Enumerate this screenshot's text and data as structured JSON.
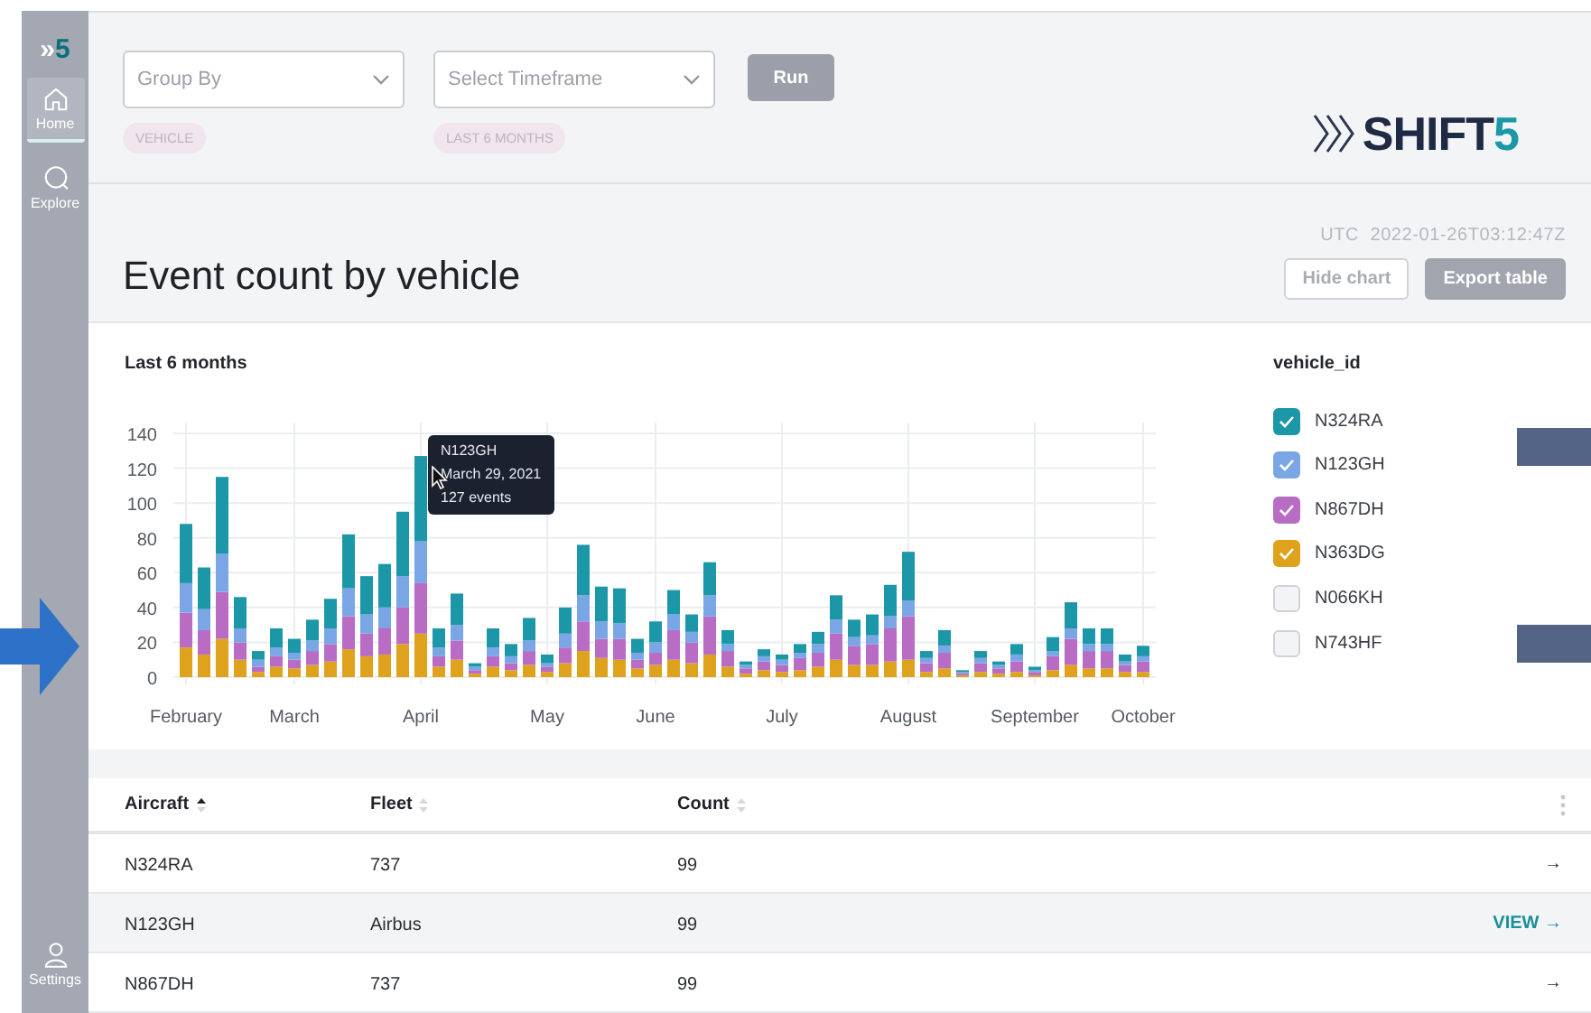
{
  "sidebar": {
    "logo": {
      "mark": "»",
      "accent": "5"
    },
    "items": [
      {
        "label": "Home",
        "selected": true
      },
      {
        "label": "Explore",
        "selected": false
      }
    ],
    "footer": {
      "label": "Settings"
    }
  },
  "toolbar": {
    "selects": [
      {
        "placeholder": "Group By",
        "chip": "VEHICLE"
      },
      {
        "placeholder": "Select Timeframe",
        "chip": "LAST 6 MONTHS"
      }
    ],
    "run_button": "Run",
    "logo": {
      "text": "SHIFT",
      "accent": "5"
    }
  },
  "report": {
    "timestamp": "UTC  2022-01-26T03:12:47Z",
    "title": "Event count by vehicle",
    "buttons": [
      {
        "label": "Hide chart",
        "kind": "outline"
      },
      {
        "label": "Export table",
        "kind": "filled"
      }
    ]
  },
  "chart": {
    "subtitle": "Last 6 months",
    "tooltip": [
      "N123GH",
      "March 29, 2021",
      "127 events"
    ],
    "chart_data": {
      "type": "bar",
      "stacked": true,
      "grid": true,
      "categories": [
        "February",
        null,
        null,
        null,
        null,
        null,
        "March",
        null,
        null,
        null,
        null,
        null,
        null,
        "April",
        null,
        null,
        null,
        null,
        null,
        null,
        "May",
        null,
        null,
        null,
        null,
        null,
        "June",
        null,
        null,
        null,
        null,
        null,
        null,
        "July",
        null,
        null,
        null,
        null,
        null,
        null,
        "August",
        null,
        null,
        null,
        null,
        null,
        null,
        "September",
        null,
        null,
        null,
        null,
        null,
        "October"
      ],
      "ylim": [
        0,
        140
      ],
      "yticks": [
        0,
        20,
        40,
        60,
        80,
        100,
        120,
        140
      ],
      "series": [
        {
          "color": "#dea21c",
          "values": [
            17,
            13,
            22,
            10,
            3,
            6,
            5,
            7,
            9,
            16,
            12,
            13,
            19,
            25,
            6,
            10,
            2,
            6,
            4,
            7,
            3,
            8,
            15,
            11,
            10,
            5,
            7,
            10,
            8,
            13,
            6,
            2,
            4,
            3,
            4,
            6,
            10,
            7,
            7,
            9,
            10,
            3,
            5,
            1,
            3,
            2,
            3,
            1,
            4,
            7,
            5,
            5,
            3,
            3
          ]
        },
        {
          "color": "#b86cc4",
          "values": [
            20,
            14,
            27,
            10,
            3,
            6,
            5,
            8,
            10,
            19,
            13,
            15,
            21,
            29,
            6,
            11,
            2,
            6,
            4,
            8,
            3,
            9,
            17,
            11,
            12,
            5,
            7,
            17,
            12,
            22,
            9,
            3,
            5,
            4,
            7,
            8,
            15,
            11,
            12,
            19,
            25,
            5,
            9,
            1,
            5,
            3,
            6,
            2,
            8,
            15,
            10,
            10,
            4,
            6
          ]
        },
        {
          "color": "#7aa6e6",
          "values": [
            17,
            12,
            22,
            8,
            4,
            5,
            4,
            6,
            9,
            16,
            11,
            12,
            18,
            24,
            5,
            9,
            2,
            5,
            4,
            6,
            2,
            8,
            15,
            10,
            9,
            4,
            6,
            9,
            6,
            12,
            4,
            2,
            3,
            3,
            3,
            5,
            8,
            5,
            5,
            7,
            9,
            3,
            4,
            1,
            3,
            2,
            4,
            1,
            3,
            6,
            4,
            4,
            2,
            3
          ]
        },
        {
          "color": "#1b97a8",
          "values": [
            34,
            24,
            44,
            18,
            5,
            11,
            8,
            12,
            17,
            31,
            22,
            25,
            37,
            49,
            11,
            18,
            2,
            11,
            7,
            13,
            5,
            15,
            29,
            20,
            20,
            8,
            12,
            14,
            10,
            19,
            8,
            2,
            4,
            3,
            5,
            7,
            14,
            10,
            12,
            18,
            28,
            4,
            9,
            1,
            4,
            2,
            6,
            2,
            8,
            15,
            9,
            9,
            4,
            6
          ]
        }
      ]
    },
    "legend": {
      "title": "vehicle_id",
      "items": [
        {
          "label": "N324RA",
          "checked": true,
          "color": "#1b97a8"
        },
        {
          "label": "N123GH",
          "checked": true,
          "color": "#7aa6e6"
        },
        {
          "label": "N867DH",
          "checked": true,
          "color": "#b86cc4"
        },
        {
          "label": "N363DG",
          "checked": true,
          "color": "#dea21c"
        },
        {
          "label": "N066KH",
          "checked": false,
          "color": "#f3f4f5"
        },
        {
          "label": "N743HF",
          "checked": false,
          "color": "#f3f4f5"
        }
      ]
    }
  },
  "table": {
    "columns": [
      {
        "label": "Aircraft",
        "sorted": true
      },
      {
        "label": "Fleet",
        "sorted": false
      },
      {
        "label": "Count",
        "sorted": false
      }
    ],
    "rows": [
      {
        "cells": [
          "N324RA",
          "737",
          "99"
        ],
        "hovered": false,
        "action": "→"
      },
      {
        "cells": [
          "N123GH",
          "Airbus",
          "99"
        ],
        "hovered": true,
        "action": "VIEW →"
      },
      {
        "cells": [
          "N867DH",
          "737",
          "99"
        ],
        "hovered": false,
        "action": "→"
      }
    ]
  }
}
